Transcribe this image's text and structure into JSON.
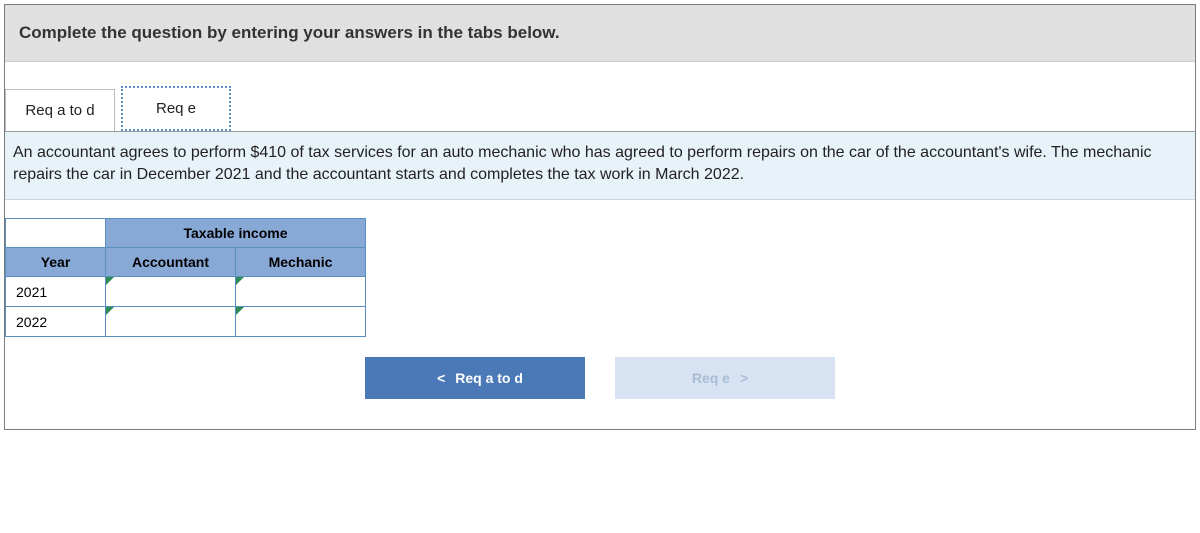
{
  "instructions": "Complete the question by entering your answers in the tabs below.",
  "tabs": {
    "inactive_label": "Req a to d",
    "active_label": "Req e"
  },
  "prompt": "An accountant agrees to perform $410 of tax services for an auto mechanic who has agreed to perform repairs on the car of the accountant's wife. The mechanic repairs the car in December 2021 and the accountant starts and completes the tax work in March 2022.",
  "table": {
    "span_header": "Taxable income",
    "col_year": "Year",
    "col_accountant": "Accountant",
    "col_mechanic": "Mechanic",
    "rows": [
      {
        "year": "2021",
        "accountant": "",
        "mechanic": ""
      },
      {
        "year": "2022",
        "accountant": "",
        "mechanic": ""
      }
    ]
  },
  "nav": {
    "prev_label": "Req a to d",
    "next_label": "Req e",
    "left_chevron": "<",
    "right_chevron": ">"
  }
}
